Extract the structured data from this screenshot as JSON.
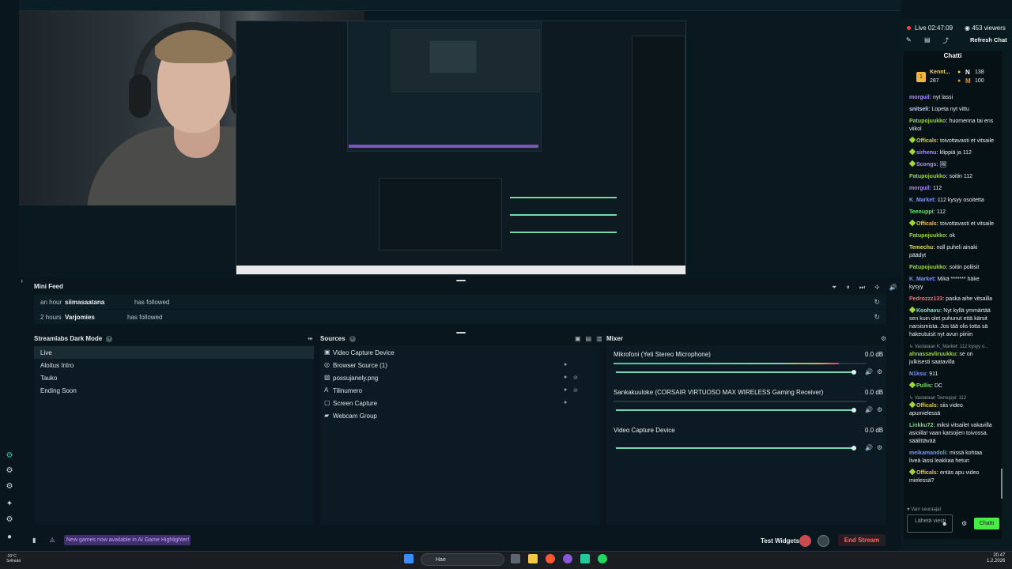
{
  "stream": {
    "live_text": "Live 02:47:09",
    "viewers": "453 viewers",
    "refresh_chat": "Refresh Chat"
  },
  "minifeed": {
    "title": "Mini Feed",
    "items": [
      {
        "time": "an hour",
        "name": "siimasaatana",
        "action": "has followed"
      },
      {
        "time": "2 hours",
        "name": "Varjomies",
        "action": "has followed"
      }
    ]
  },
  "scenes": {
    "title": "Streamlabs Dark Mode",
    "items": [
      "Live",
      "Aloitus Intro",
      "Tauko",
      "Ending Soon"
    ]
  },
  "sources": {
    "title": "Sources",
    "items": [
      "Video Capture Device",
      "Browser Source (1)",
      "possujanely.png",
      "Tilinumero",
      "Screen Capture",
      "Webcam Group"
    ]
  },
  "mixer": {
    "title": "Mixer",
    "channels": [
      {
        "name": "Mikrofoni (Yeti Stereo Microphone)",
        "db": "0.0 dB",
        "level": 0.89
      },
      {
        "name": "Sankakuuloke (CORSAIR VIRTUOSO MAX WIRELESS Gaming Receiver)",
        "db": "0.0 dB",
        "level": 0
      },
      {
        "name": "Video Capture Device",
        "db": "0.0 dB",
        "level": 0
      }
    ]
  },
  "bottom": {
    "promo": "New games now available in AI Game Highlighter!",
    "test_widgets": "Test Widgets",
    "end_stream": "End Stream"
  },
  "chat": {
    "title": "Chatti",
    "leader": {
      "name": "Kennt...",
      "points": "287",
      "n_label": "N",
      "n_value": "138",
      "m_label": "M",
      "m_value": "100"
    },
    "messages": [
      {
        "user": "morguil:",
        "text": "nyt lassi",
        "color": "#b28cff"
      },
      {
        "user": "snitseli:",
        "text": "Lopeta nyt vittu",
        "color": "#c8d3ff"
      },
      {
        "user": "Patupojuukko:",
        "text": "huomenna tai ens viikol",
        "color": "#9ed638"
      },
      {
        "user": "Officals:",
        "text": "toivottavasti et vitsaile",
        "color": "#e8c34e",
        "tag": true
      },
      {
        "user": "sirhenu:",
        "text": "klippiä ja 112",
        "color": "#b28cff",
        "tag": true
      },
      {
        "user": "Scongs:",
        "text": "🖼",
        "color": "#b28cff",
        "tag": true
      },
      {
        "user": "Patupojuukko:",
        "text": "soitin 112",
        "color": "#9ed638"
      },
      {
        "user": "morguil:",
        "text": "112",
        "color": "#b28cff"
      },
      {
        "user": "K_Market:",
        "text": "112 kysyy osoitetta",
        "color": "#7c96ff"
      },
      {
        "user": "Teenuppi:",
        "text": "112",
        "color": "#77e06a"
      },
      {
        "user": "Officals:",
        "text": "toivottavasti et vitsaile",
        "color": "#e8c34e",
        "tag": true
      },
      {
        "user": "Patupojuukko:",
        "text": "ok",
        "color": "#9ed638"
      },
      {
        "user": "Temechu:",
        "text": "noll puheli ainaki päädyt",
        "color": "#e9d36f"
      },
      {
        "user": "Patupojuukko:",
        "text": "soitin poliisit",
        "color": "#9ed638"
      },
      {
        "user": "K_Market:",
        "text": "Mikä ******* häke kysyy",
        "color": "#7c96ff"
      },
      {
        "user": "Pedrozzz133:",
        "text": "paska aihe vitsailla",
        "color": "#ff6d78"
      },
      {
        "user": "Koohavu:",
        "text": "Nyt kyllä ymmärtää sen kuin olet puhunut että kärsit narsismista. Jos tää olis totta sä hakeutuisit nyt avun piiriin",
        "color": "#7ee8c8",
        "tag": true
      },
      {
        "reply": "Vastataan K_Market: 112 kysyy o..."
      },
      {
        "user": "ahnassavliruukku:",
        "text": "se on julkisesti saatavilla",
        "color": "#9ed638"
      },
      {
        "user": "N1ksu:",
        "text": "911",
        "color": "#7c96ff"
      },
      {
        "user": "Pullis:",
        "text": "DC",
        "color": "#77e06a",
        "tag": true
      },
      {
        "reply": "Vastataan Teenuppi: 112"
      },
      {
        "user": "Officals:",
        "text": "siis video apumielessä",
        "color": "#e8c34e",
        "tag": true
      },
      {
        "user": "Linkku72:",
        "text": "miksi vitsailet vakavilla asioilla! vaan katsojien toivossa. säälittävää",
        "color": "#77e06a"
      },
      {
        "user": "meikamandoli:",
        "text": "missä kohtaa liveä lassi leakkaa hetun",
        "color": "#7c96ff"
      },
      {
        "user": "Officals:",
        "text": "entäs apu video mielessä?",
        "color": "#e8c34e",
        "tag": true
      }
    ],
    "follower_note": "Vain seuraajat",
    "input_placeholder": "Lähetä viesti",
    "send_button": "Chatti"
  },
  "taskbar": {
    "weather": "-20°C",
    "weather_state": "Selkeää",
    "search": "Hae",
    "time": "20.47",
    "date": "1.2.2026"
  }
}
